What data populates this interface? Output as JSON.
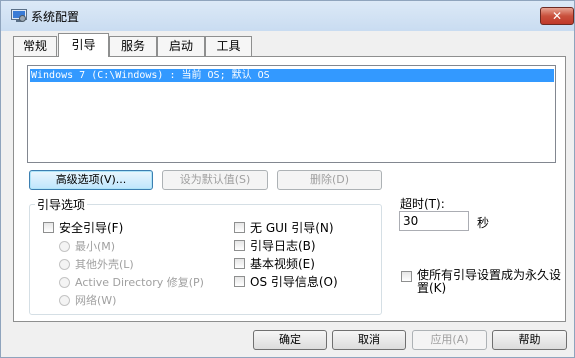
{
  "window": {
    "title": "系统配置",
    "close_label": "✕"
  },
  "tabs": [
    {
      "label": "常规"
    },
    {
      "label": "引导"
    },
    {
      "label": "服务"
    },
    {
      "label": "启动"
    },
    {
      "label": "工具"
    }
  ],
  "os_list": [
    "Windows 7 (C:\\Windows) : 当前 OS; 默认 OS"
  ],
  "buttons": {
    "advanced": "高级选项(V)...",
    "set_default": "设为默认值(S)",
    "delete": "删除(D)",
    "ok": "确定",
    "cancel": "取消",
    "apply": "应用(A)",
    "help": "帮助"
  },
  "boot_options": {
    "title": "引导选项",
    "safe_boot": "安全引导(F)",
    "minimal": "最小(M)",
    "alt_shell": "其他外壳(L)",
    "ad_repair": "Active Directory 修复(P)",
    "network": "网络(W)",
    "no_gui": "无 GUI 引导(N)",
    "boot_log": "引导日志(B)",
    "base_video": "基本视频(E)",
    "os_boot_info": "OS 引导信息(O)"
  },
  "timeout": {
    "label": "超时(T):",
    "value": "30",
    "unit": "秒"
  },
  "make_permanent": "使所有引导设置成为永久设置(K)"
}
